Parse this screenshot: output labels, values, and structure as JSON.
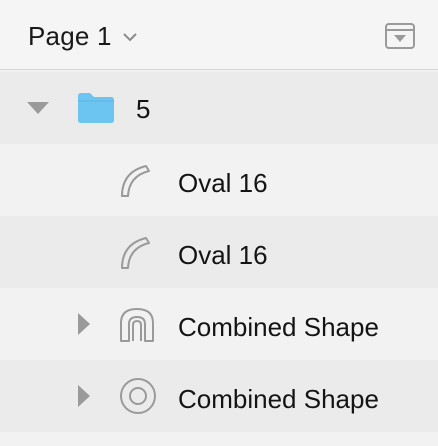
{
  "header": {
    "page_title": "Page 1",
    "dropdown_icon": "chevron-down-icon",
    "collapse_icon": "collapse-panel-icon"
  },
  "layers": [
    {
      "label": "5",
      "icon": "folder-icon",
      "disclosure": "expanded"
    },
    {
      "label": "Oval 16",
      "icon": "open-path-icon",
      "disclosure": "none"
    },
    {
      "label": "Oval 16",
      "icon": "open-path-icon",
      "disclosure": "none"
    },
    {
      "label": "Combined Shape",
      "icon": "combined-shape-arch-icon",
      "disclosure": "collapsed"
    },
    {
      "label": "Combined Shape",
      "icon": "combined-shape-ring-icon",
      "disclosure": "collapsed"
    }
  ],
  "colors": {
    "folder": "#6cc4f0",
    "icon_stroke": "#9a9a9a",
    "row_alt": "#ebebeb",
    "row_plain": "#f2f2f2"
  }
}
